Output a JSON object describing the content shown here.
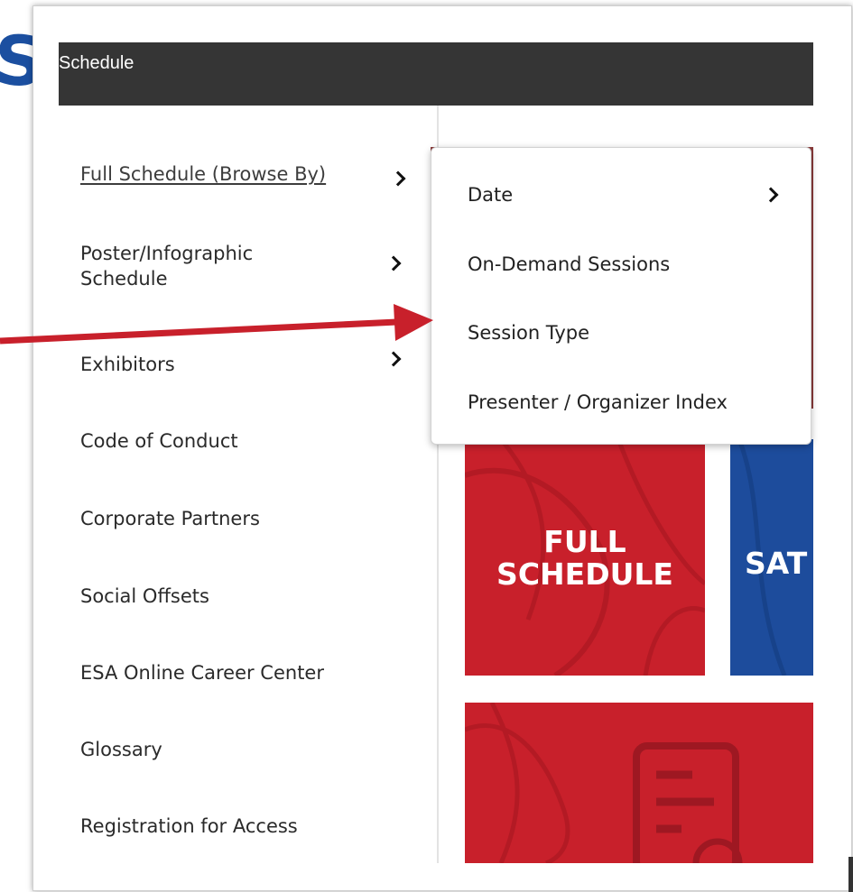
{
  "header": {
    "title": "Schedule"
  },
  "edge_glyph": "S",
  "sidebar": {
    "items": [
      {
        "label": "Full Schedule (Browse By)",
        "has_submenu": true
      },
      {
        "label": "Poster/Infographic Schedule",
        "has_submenu": true
      },
      {
        "label": "Exhibitors",
        "has_submenu": true
      },
      {
        "label": "Code of Conduct",
        "has_submenu": false
      },
      {
        "label": "Corporate Partners",
        "has_submenu": false
      },
      {
        "label": "Social Offsets",
        "has_submenu": false
      },
      {
        "label": "ESA Online Career Center",
        "has_submenu": false
      },
      {
        "label": "Glossary",
        "has_submenu": false
      },
      {
        "label": "Registration for Access",
        "has_submenu": false
      }
    ]
  },
  "dropdown": {
    "items": [
      {
        "label": "Date",
        "has_submenu": true
      },
      {
        "label": "On-Demand Sessions",
        "has_submenu": false
      },
      {
        "label": "Session Type",
        "has_submenu": false
      },
      {
        "label": "Presenter / Organizer Index",
        "has_submenu": false
      }
    ]
  },
  "tiles": {
    "full_schedule": {
      "line1": "FULL",
      "line2": "SCHEDULE"
    },
    "saturday": {
      "label": "SAT"
    }
  },
  "colors": {
    "header_bg": "#353535",
    "tile_red": "#c8202b",
    "tile_blue": "#1d4c9c",
    "annotation_arrow": "#c8202b",
    "edge_glyph": "#1b4fa0"
  },
  "icons": [
    "chevron-right-icon",
    "document-icon",
    "gear-icon",
    "annotation-arrow"
  ]
}
